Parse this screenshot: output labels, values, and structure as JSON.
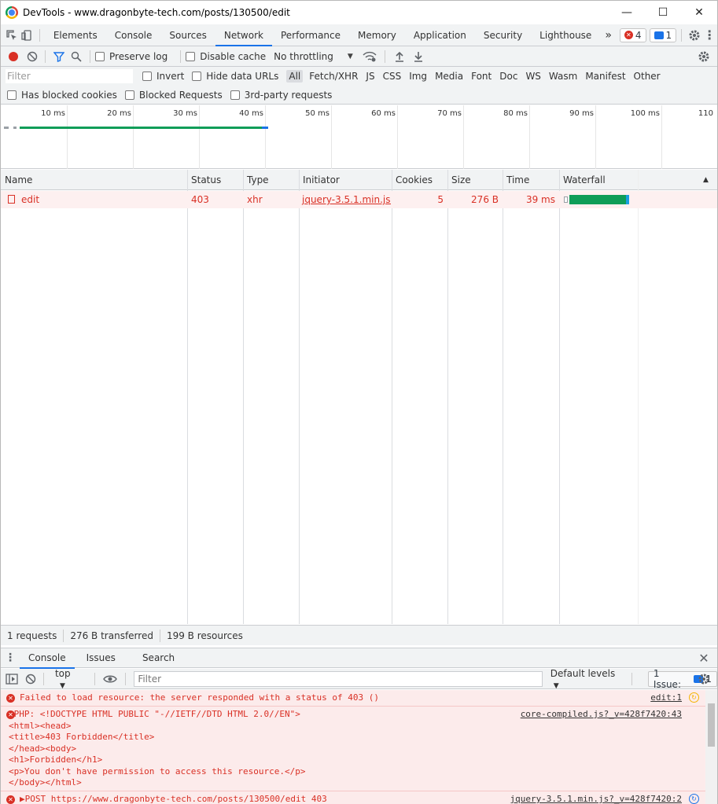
{
  "window": {
    "title": "DevTools - www.dragonbyte-tech.com/posts/130500/edit",
    "minimize": "—",
    "maximize": "☐",
    "close": "✕"
  },
  "tabs": [
    "Elements",
    "Console",
    "Sources",
    "Network",
    "Performance",
    "Memory",
    "Application",
    "Security",
    "Lighthouse"
  ],
  "tabs_more": "»",
  "badges": {
    "errors": "4",
    "messages": "1"
  },
  "network_toolbar": {
    "preserve_log": "Preserve log",
    "disable_cache": "Disable cache",
    "throttling": "No throttling"
  },
  "filter": {
    "placeholder": "Filter",
    "invert": "Invert",
    "hide_data_urls": "Hide data URLs",
    "types": [
      "All",
      "Fetch/XHR",
      "JS",
      "CSS",
      "Img",
      "Media",
      "Font",
      "Doc",
      "WS",
      "Wasm",
      "Manifest",
      "Other"
    ],
    "has_blocked_cookies": "Has blocked cookies",
    "blocked_requests": "Blocked Requests",
    "third_party": "3rd-party requests"
  },
  "overview_ticks": [
    "10 ms",
    "20 ms",
    "30 ms",
    "40 ms",
    "50 ms",
    "60 ms",
    "70 ms",
    "80 ms",
    "90 ms",
    "100 ms",
    "110"
  ],
  "columns": [
    "Name",
    "Status",
    "Type",
    "Initiator",
    "Cookies",
    "Size",
    "Time",
    "Waterfall"
  ],
  "requests": [
    {
      "name": "edit",
      "status": "403",
      "type": "xhr",
      "initiator": "jquery-3.5.1.min.js...",
      "cookies": "5",
      "size": "276 B",
      "time": "39 ms"
    }
  ],
  "summary": {
    "requests": "1 requests",
    "transferred": "276 B transferred",
    "resources": "199 B resources"
  },
  "drawer": {
    "tabs": [
      "Console",
      "Issues",
      "Search"
    ],
    "context": "top",
    "filter_placeholder": "Filter",
    "levels": "Default levels",
    "issues_btn": "1 Issue:",
    "issues_count": "1"
  },
  "console_messages": [
    {
      "text": "Failed to load resource: the server responded with a status of 403 ()",
      "source": "edit:1"
    },
    {
      "text": "▶PHP: <!DOCTYPE HTML PUBLIC \"-//IETF//DTD HTML 2.0//EN\">\n<html><head>\n<title>403 Forbidden</title>\n</head><body>\n<h1>Forbidden</h1>\n<p>You don't have permission to access this resource.</p>\n</body></html>",
      "source": "core-compiled.js?_v=428f7420:43"
    },
    {
      "text": "▶POST https://www.dragonbyte-tech.com/posts/130500/edit 403",
      "source": "jquery-3.5.1.min.js?_v=428f7420:2"
    }
  ]
}
